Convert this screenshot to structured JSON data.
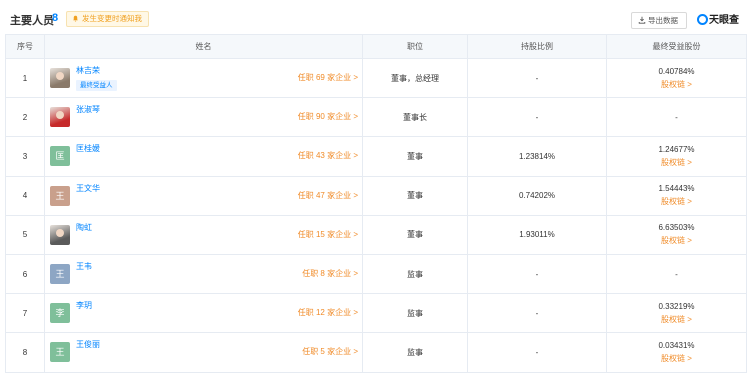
{
  "header": {
    "title": "主要人员",
    "count": "8",
    "notice": "发生变更时通知我",
    "export_label": "导出数据",
    "brand": "天眼查"
  },
  "table": {
    "columns": [
      "序号",
      "姓名",
      "职位",
      "持股比例",
      "最终受益股份"
    ],
    "rows": [
      {
        "index": "1",
        "name": "林吉荣",
        "tag": "最终受益人",
        "avatar_text": "",
        "avatar_type": "photo",
        "avatar_color": "#8a7a6a",
        "posts": "任职 69 家企业 >",
        "position": "董事，总经理",
        "holding": "-",
        "final_pct": "0.40784%",
        "chain": "股权链 >"
      },
      {
        "index": "2",
        "name": "张淑琴",
        "tag": "",
        "avatar_text": "",
        "avatar_type": "photo",
        "avatar_color": "#c62a2a",
        "posts": "任职 90 家企业 >",
        "position": "董事长",
        "holding": "-",
        "final_pct": "-",
        "chain": ""
      },
      {
        "index": "3",
        "name": "匡桂媛",
        "tag": "",
        "avatar_text": "匡",
        "avatar_type": "letter",
        "avatar_color": "#7fbf9a",
        "posts": "任职 43 家企业 >",
        "position": "董事",
        "holding": "1.23814%",
        "final_pct": "1.24677%",
        "chain": "股权链 >"
      },
      {
        "index": "4",
        "name": "王文华",
        "tag": "",
        "avatar_text": "王",
        "avatar_type": "letter",
        "avatar_color": "#c9a08c",
        "posts": "任职 47 家企业 >",
        "position": "董事",
        "holding": "0.74202%",
        "final_pct": "1.54443%",
        "chain": "股权链 >"
      },
      {
        "index": "5",
        "name": "陶虹",
        "tag": "",
        "avatar_text": "",
        "avatar_type": "photo",
        "avatar_color": "#5a5a5a",
        "posts": "任职 15 家企业 >",
        "position": "董事",
        "holding": "1.93011%",
        "final_pct": "6.63503%",
        "chain": "股权链 >"
      },
      {
        "index": "6",
        "name": "王韦",
        "tag": "",
        "avatar_text": "王",
        "avatar_type": "letter",
        "avatar_color": "#8da6c4",
        "posts": "任职 8 家企业 >",
        "position": "监事",
        "holding": "-",
        "final_pct": "-",
        "chain": ""
      },
      {
        "index": "7",
        "name": "李玥",
        "tag": "",
        "avatar_text": "李",
        "avatar_type": "letter",
        "avatar_color": "#7fbf9a",
        "posts": "任职 12 家企业 >",
        "position": "监事",
        "holding": "-",
        "final_pct": "0.33219%",
        "chain": "股权链 >"
      },
      {
        "index": "8",
        "name": "王俊丽",
        "tag": "",
        "avatar_text": "王",
        "avatar_type": "letter",
        "avatar_color": "#7fbf9a",
        "posts": "任职 5 家企业 >",
        "position": "监事",
        "holding": "-",
        "final_pct": "0.03431%",
        "chain": "股权链 >"
      }
    ]
  },
  "colors": {
    "accent": "#0084ff",
    "link_orange": "#f08b28",
    "header_bg": "#f5f8fb"
  }
}
